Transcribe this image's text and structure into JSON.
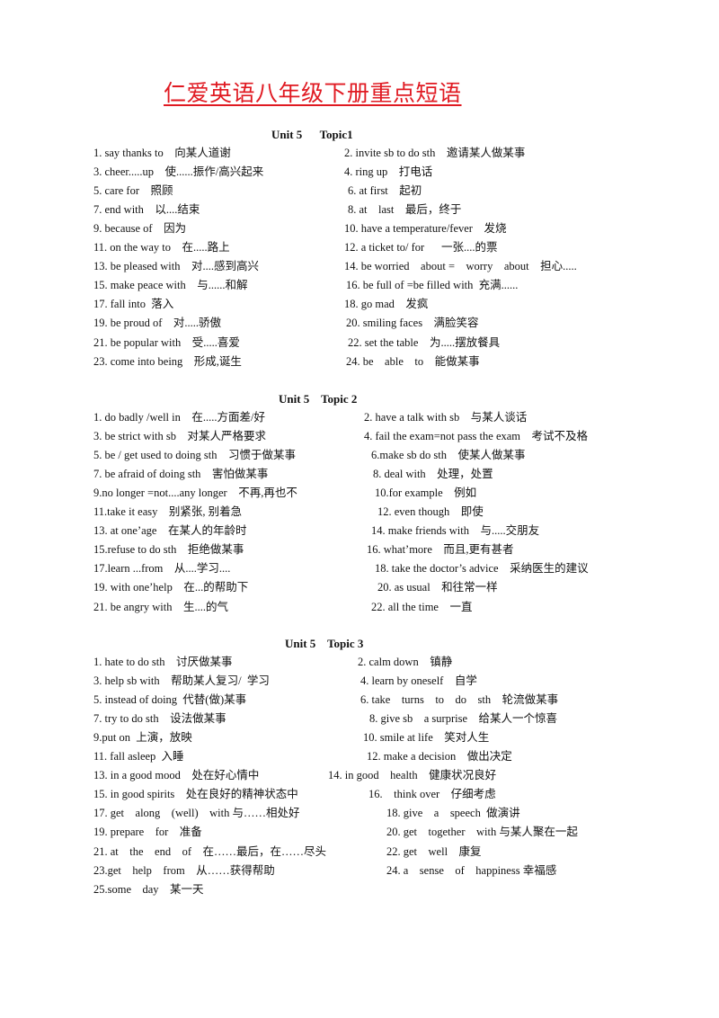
{
  "title": "仁爱英语八年级下册重点短语",
  "sections": [
    {
      "heading": "Unit 5      Topic1",
      "left": [
        "1. say thanks to    向某人道谢",
        "3. cheer.....up    使......振作/高兴起来",
        "5. care for    照顾",
        "7. end with    以....结束",
        "9. because of    因为",
        "11. on the way to    在.....路上",
        "13. be pleased with    对....感到高兴",
        "15. make peace with    与......和解",
        "17. fall into  落入",
        "19. be proud of    对.....骄傲",
        "21. be popular with    受.....喜爱",
        "23. come into being    形成,诞生"
      ],
      "right": [
        "2. invite sb to do sth    邀请某人做某事",
        "4. ring up    打电话",
        " 6. at first    起初",
        " 8. at    last    最后，终于",
        "10. have a temperature/fever    发烧",
        "12. a ticket to/ for      一张....的票",
        "14. be worried    about =    worry    about    担心.....",
        "  16. be full of =be filled with  充满......",
        "18. go mad    发疯",
        "  20. smiling faces    满脸笑容",
        "   22. set the table    为.....摆放餐具",
        "  24. be    able    to    能做某事"
      ]
    },
    {
      "heading": "Unit 5    Topic 2",
      "left": [
        "1. do badly /well in    在.....方面差/好",
        "3. be strict with sb    对某人严格要求",
        "5. be / get used to doing sth    习惯于做某事",
        "7. be afraid of doing sth    害怕做某事",
        "9.no longer =not....any longer    不再,再也不",
        "11.take it easy    别紧张, 别着急",
        "13. at one’age    在某人的年龄时",
        "15.refuse to do sth    拒绝做某事",
        "17.learn ...from    从....学习....",
        "19. with one’help    在...的帮助下",
        "21. be angry with    生....的气"
      ],
      "right": [
        "2. have a talk with sb    与某人谈话",
        "  4. fail the exam=not pass the exam    考试不及格",
        " 6.make sb do sth    使某人做某事",
        "  8. deal with    处理，处置",
        "  10.for example    例如",
        "    12. even though    即使",
        "14. make friends with    与.....交朋友",
        "16. what’more    而且,更有甚者",
        " 18. take the doctor’s advice    采纳医生的建议",
        "  20. as usual    和往常一样",
        "22. all the time    一直"
      ]
    },
    {
      "heading": "Unit 5    Topic 3",
      "left": [
        "1. hate to do sth    讨厌做某事",
        "3. help sb with    帮助某人复习/  学习",
        "5. instead of doing  代替(做)某事",
        "7. try to do sth    设法做某事",
        "9.put on  上演，放映",
        "11. fall asleep  入睡",
        "13. in a good mood    处在好心情中",
        "15. in good spirits    处在良好的精神状态中",
        "17. get    along    (well)    with 与……相处好",
        "19. prepare    for    准备",
        "21. at    the    end    of    在……最后，在……尽头",
        "23.get    help    from    从……获得帮助",
        "25.some    day    某一天"
      ],
      "right": [
        "2. calm down    镇静",
        " 4. learn by oneself    自学",
        "6. take    turns    to    do    sth    轮流做某事",
        "  8. give sb    a surprise    给某人一个惊喜",
        " 10. smile at life    笑对人生",
        "  12. make a decision    做出决定",
        "14. in good    health    健康状况良好",
        "16.    think over    仔细考虑",
        "18. give    a    speech  做演讲",
        "20. get    together    with 与某人聚在一起",
        "22. get    well    康复",
        "24. a    sense    of    happiness 幸福感",
        ""
      ]
    }
  ]
}
